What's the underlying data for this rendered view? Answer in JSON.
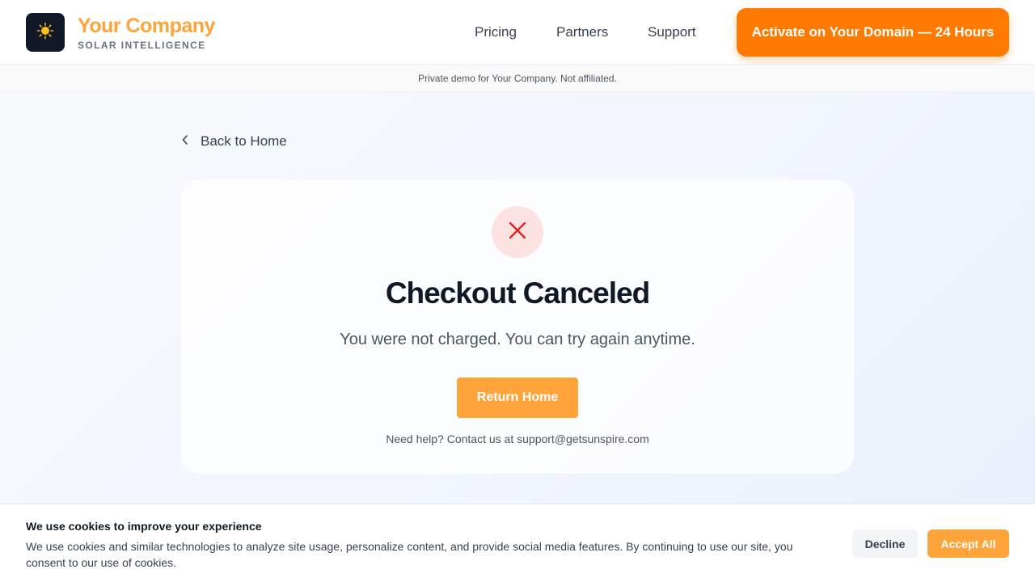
{
  "header": {
    "brand_name": "Your Company",
    "brand_tagline": "SOLAR INTELLIGENCE",
    "logo_icon": "sun-icon",
    "nav": [
      {
        "label": "Pricing"
      },
      {
        "label": "Partners"
      },
      {
        "label": "Support"
      }
    ],
    "cta_label": "Activate on Your Domain — 24 Hours"
  },
  "disclaimer": "Private demo for Your Company. Not affiliated.",
  "back_link": {
    "label": "Back to Home",
    "icon": "chevron-left-icon"
  },
  "card": {
    "status_icon": "close-icon",
    "title": "Checkout Canceled",
    "subtitle": "You were not charged. You can try again anytime.",
    "button_label": "Return Home",
    "help_text": "Need help? Contact us at support@getsunspire.com"
  },
  "cookie_banner": {
    "title": "We use cookies to improve your experience",
    "text": "We use cookies and similar technologies to analyze site usage, personalize content, and provide social media features. By continuing to use our site, you consent to our use of cookies.",
    "decline_label": "Decline",
    "accept_label": "Accept All"
  },
  "colors": {
    "brand_orange": "#ffa43a",
    "cta_orange": "#ff7a00",
    "error_red": "#dc2626",
    "error_bg": "#fde2e2",
    "dark": "#111827"
  }
}
